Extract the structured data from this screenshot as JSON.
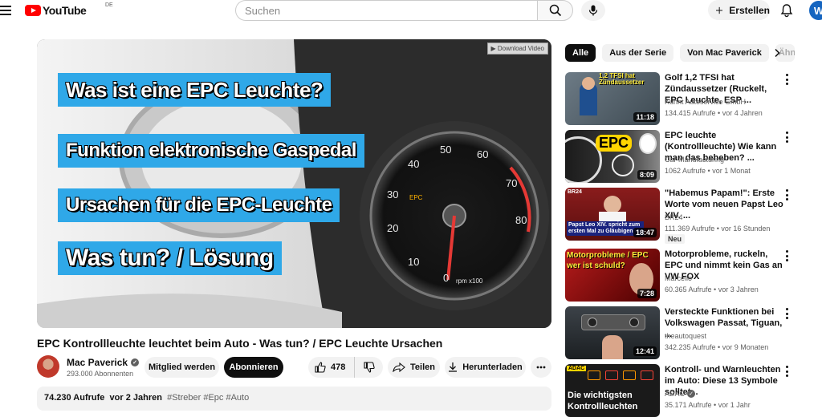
{
  "header": {
    "logo_text": "YouTube",
    "country_code": "DE",
    "search_placeholder": "Suchen",
    "create_label": "Erstellen",
    "avatar_initial": "W"
  },
  "player": {
    "download_badge": "▶ Download Video",
    "banners": [
      "Was ist eine EPC Leuchte?",
      "Funktion elektronische Gaspedal",
      "Ursachen für die EPC-Leuchte",
      "Was tun? / Lösung"
    ],
    "gauge_labels": [
      "10",
      "20",
      "30",
      "40",
      "50",
      "60",
      "70",
      "80"
    ],
    "gauge_zero": "0",
    "gauge_unit": "rpm x100",
    "gauge_epc": "EPC"
  },
  "video": {
    "title": "EPC Kontrollleuchte leuchtet beim Auto - Was tun? / EPC Leuchte Ursachen",
    "channel_name": "Mac Paverick",
    "subscribers": "293.000 Abonnenten",
    "join_label": "Mitglied werden",
    "subscribe_label": "Abonnieren",
    "likes": "478",
    "share_label": "Teilen",
    "download_label": "Herunterladen",
    "views": "74.230 Aufrufe",
    "age": "vor 2 Jahren",
    "hashtags": "#Streber #Epc #Auto"
  },
  "chips": [
    "Alle",
    "Aus der Serie",
    "Von Mac Paverick",
    "Ähn"
  ],
  "related": [
    {
      "title": "Golf 1,2 TFSI hat Zündaussetzer (Ruckelt, EPC Leuchte, ESP ...",
      "channel": "Kuhnt Autoservice GmbH",
      "verified": false,
      "meta": "134.415 Aufrufe • vor 4 Jahren",
      "duration": "11:18",
      "thumb_text": "1,2 TFSI hat Zündaussetzer",
      "badge": ""
    },
    {
      "title": "EPC leuchte (Kontrollleuchte) Wie kann man das beheben? ...",
      "channel": "Car Manufacturing",
      "verified": false,
      "meta": "1062 Aufrufe • vor 1 Monat",
      "duration": "8:09",
      "thumb_text": "EPC",
      "badge": ""
    },
    {
      "title": "\"Habemus Papam!\": Erste Worte vom neuen Papst Leo XIV. ...",
      "channel": "BR24",
      "verified": false,
      "meta": "111.369 Aufrufe • vor 16 Stunden",
      "duration": "18:47",
      "thumb_text": "Papst Leo XIV. spricht zum ersten Mal zu Gläubigen",
      "badge": "Neu"
    },
    {
      "title": "Motorprobleme, ruckeln, EPC und nimmt kein Gas an VW FOX",
      "channel": "Marcello",
      "verified": false,
      "meta": "60.365 Aufrufe • vor 3 Jahren",
      "duration": "7:28",
      "thumb_text": "Motorprobleme / EPC wer ist schuld?",
      "badge": ""
    },
    {
      "title": "Versteckte Funktionen bei Volkswagen Passat, Tiguan, ...",
      "channel": "theautoquest",
      "verified": false,
      "meta": "342.235 Aufrufe • vor 9 Monaten",
      "duration": "12:41",
      "thumb_text": "",
      "badge": ""
    },
    {
      "title": "Kontroll- und Warnleuchten im Auto: Diese 13 Symbole solltet...",
      "channel": "ADAC",
      "verified": true,
      "meta": "35.171 Aufrufe • vor 1 Jahr",
      "duration": "",
      "thumb_text": "Die wichtigsten Kontrollleuchten",
      "badge": ""
    }
  ],
  "colors": {
    "accent_red": "#ff0000",
    "banner_blue": "#2fa8e8",
    "avatar_blue": "#1565c0"
  }
}
